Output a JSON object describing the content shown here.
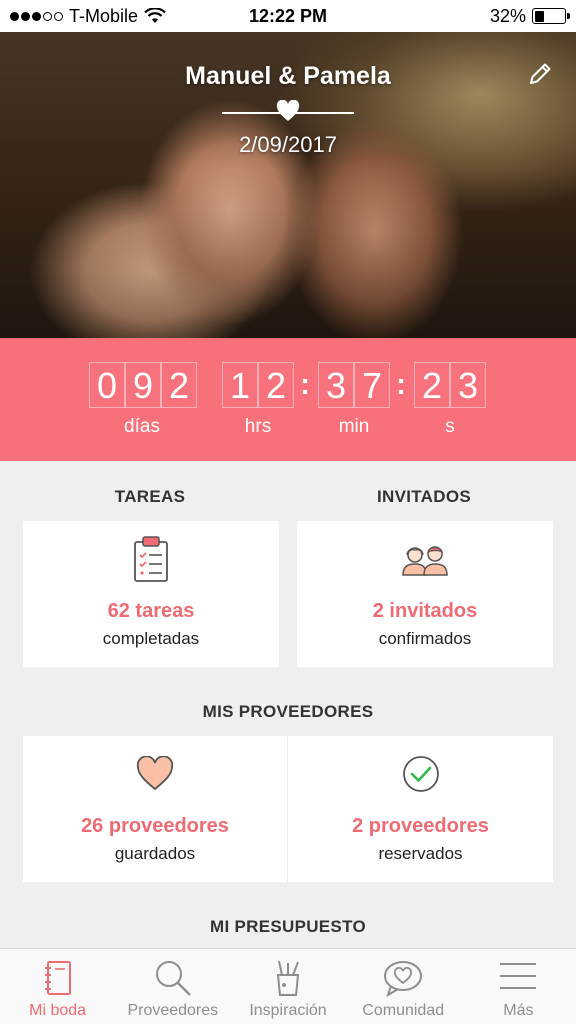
{
  "status_bar": {
    "carrier": "T-Mobile",
    "time": "12:22 PM",
    "battery_percent": "32%",
    "battery_level": 0.32,
    "signal_bars_filled": 3,
    "signal_bars_total": 5
  },
  "hero": {
    "couple_names": "Manuel & Pamela",
    "wedding_date": "2/09/2017"
  },
  "countdown": {
    "days_digits": [
      "0",
      "9",
      "2"
    ],
    "hours_digits": [
      "1",
      "2"
    ],
    "minutes_digits": [
      "3",
      "7"
    ],
    "seconds_digits": [
      "2",
      "3"
    ],
    "labels": {
      "days": "días",
      "hours": "hrs",
      "minutes": "min",
      "seconds": "s"
    }
  },
  "tareas": {
    "title": "TAREAS",
    "count": "62 tareas",
    "subtitle": "completadas"
  },
  "invitados": {
    "title": "INVITADOS",
    "count": "2 invitados",
    "subtitle": "confirmados"
  },
  "proveedores": {
    "title": "MIS PROVEEDORES",
    "saved_count": "26 proveedores",
    "saved_label": "guardados",
    "booked_count": "2 proveedores",
    "booked_label": "reservados"
  },
  "presupuesto": {
    "title": "MI PRESUPUESTO"
  },
  "tabbar": {
    "items": [
      {
        "label": "Mi boda",
        "icon": "notebook-icon",
        "active": true
      },
      {
        "label": "Proveedores",
        "icon": "search-icon",
        "active": false
      },
      {
        "label": "Inspiración",
        "icon": "tools-cup-icon",
        "active": false
      },
      {
        "label": "Comunidad",
        "icon": "heart-chat-icon",
        "active": false
      },
      {
        "label": "Más",
        "icon": "menu-icon",
        "active": false
      }
    ]
  },
  "colors": {
    "accent": "#f7707a",
    "accent_text": "#ef6b73",
    "check_green": "#2eb84e",
    "heart_fill": "#f9c0a6"
  }
}
